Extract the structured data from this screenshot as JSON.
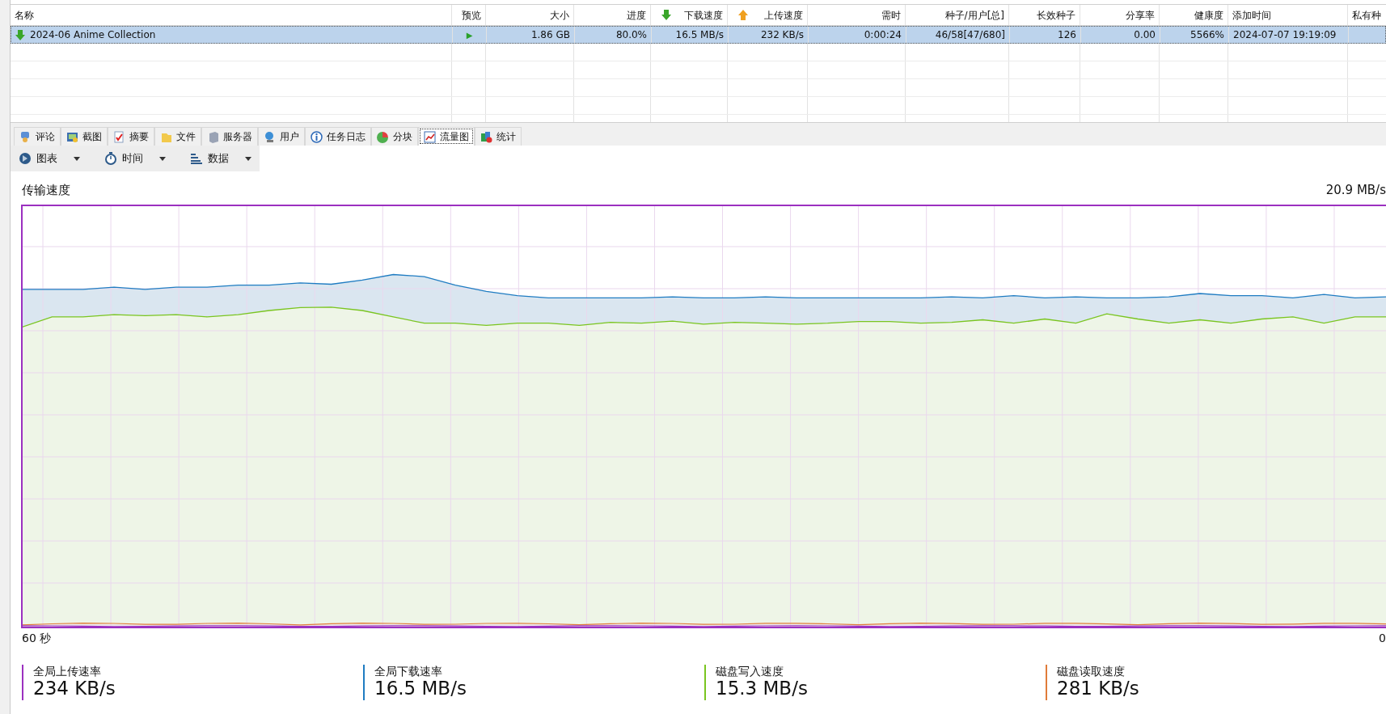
{
  "table": {
    "columns": [
      "名称",
      "预览",
      "大小",
      "进度",
      "下载速度",
      "上传速度",
      "需时",
      "种子/用户[总]",
      "长效种子",
      "分享率",
      "健康度",
      "添加时间",
      "私有种"
    ],
    "rows": [
      {
        "selected": true,
        "cells": [
          "2024-06 Anime Collection",
          "▶",
          "1.86 GB",
          "80.0%",
          "16.5 MB/s",
          "232 KB/s",
          "0:00:24",
          "46/58[47/680]",
          "126",
          "0.00",
          "5566%",
          "2024-07-07 19:19:09",
          ""
        ]
      }
    ]
  },
  "tabs": [
    {
      "label": "评论",
      "selected": false
    },
    {
      "label": "截图",
      "selected": false
    },
    {
      "label": "摘要",
      "selected": false
    },
    {
      "label": "文件",
      "selected": false
    },
    {
      "label": "服务器",
      "selected": false
    },
    {
      "label": "用户",
      "selected": false
    },
    {
      "label": "任务日志",
      "selected": false
    },
    {
      "label": "分块",
      "selected": false
    },
    {
      "label": "流量图",
      "selected": true
    },
    {
      "label": "统计",
      "selected": false
    }
  ],
  "toolbar": [
    "图表",
    "时间",
    "数据"
  ],
  "graph": {
    "title": "传输速度",
    "max_label": "20.9 MB/s",
    "x_start": "60 秒",
    "x_end": "0"
  },
  "legend": [
    {
      "label": "全局上传速率",
      "value": "234 KB/s",
      "color": "#9b30c0"
    },
    {
      "label": "全局下载速率",
      "value": "16.5 MB/s",
      "color": "#1f7cc2"
    },
    {
      "label": "磁盘写入速度",
      "value": "15.3 MB/s",
      "color": "#7ac520"
    },
    {
      "label": "磁盘读取速度",
      "value": "281 KB/s",
      "color": "#e07b39"
    }
  ]
}
